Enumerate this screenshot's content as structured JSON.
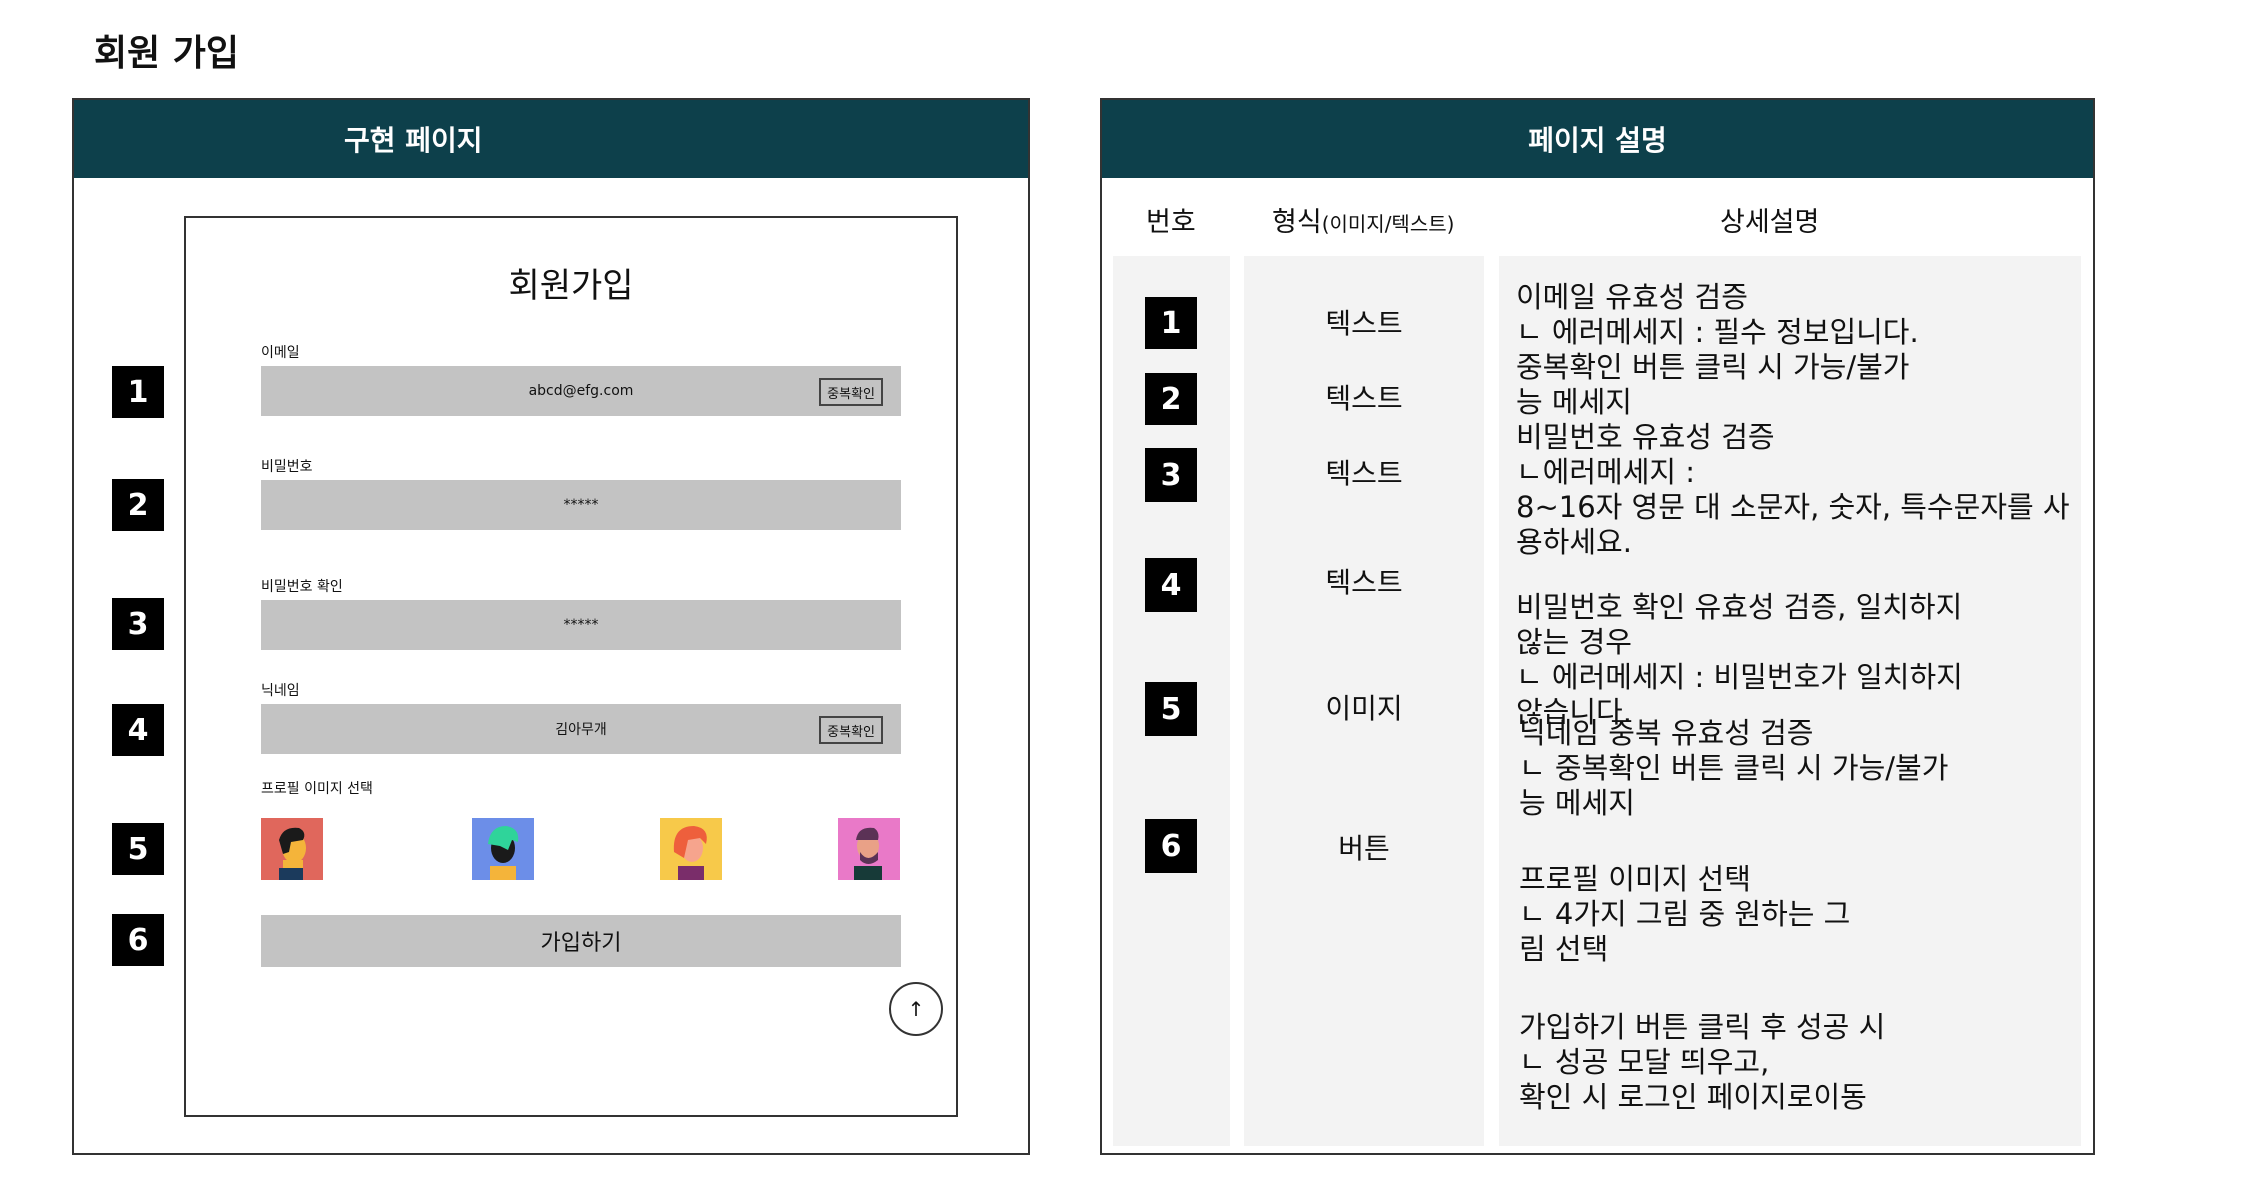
{
  "page_title": "회원 가입",
  "left": {
    "header": "구현 페이지",
    "form": {
      "title": "회원가입",
      "email_label": "이메일",
      "email_value": "abcd@efg.com",
      "dup_check_label": "중복확인",
      "password_label": "비밀번호",
      "password_value": "*****",
      "password_confirm_label": "비밀번호 확인",
      "password_confirm_value": "*****",
      "nickname_label": "닉네임",
      "nickname_value": "김아무개",
      "profile_label": "프로필 이미지 선택",
      "submit_label": "가입하기",
      "scroll_up_glyph": "↑"
    },
    "badges": [
      "1",
      "2",
      "3",
      "4",
      "5",
      "6"
    ]
  },
  "right": {
    "header": "페이지 설명",
    "columns": {
      "number": "번호",
      "format": "형식",
      "format_sub": "(이미지/텍스트)",
      "detail": "상세설명"
    },
    "numbers": [
      "1",
      "2",
      "3",
      "4",
      "5",
      "6"
    ],
    "formats": [
      "텍스트",
      "텍스트",
      "텍스트",
      "텍스트",
      "이미지",
      "버튼"
    ],
    "descriptions": [
      "이메일 유효성 검증\nㄴ 에러메세지 : 필수 정보입니다.\n중복확인 버튼 클릭 시 가능/불가\n능 메세지",
      "비밀번호 유효성 검증\nㄴ에러메세지 :\n8~16자 영문 대 소문자, 숫자, 특수문자를 사\n용하세요.",
      "비밀번호 확인 유효성 검증, 일치하지\n않는 경우\nㄴ 에러메세지 : 비밀번호가 일치하지\n않습니다.",
      "닉네임 중복 유효성 검증\nㄴ 중복확인 버튼 클릭 시 가능/불가\n능 메세지",
      "프로필 이미지 선택\nㄴ 4가지 그림 중 원하는 그\n림 선택",
      "가입하기 버튼 클릭 후 성공 시\nㄴ 성공 모달 띄우고,\n확인 시 로그인 페이지로이동"
    ]
  },
  "colors": {
    "header_bg": "#0d404b",
    "field_bg": "#c3c3c3",
    "column_bg": "#f3f3f3"
  },
  "avatar_icons": [
    "avatar-red-bg-icon",
    "avatar-blue-bg-icon",
    "avatar-yellow-bg-icon",
    "avatar-pink-bg-icon"
  ]
}
